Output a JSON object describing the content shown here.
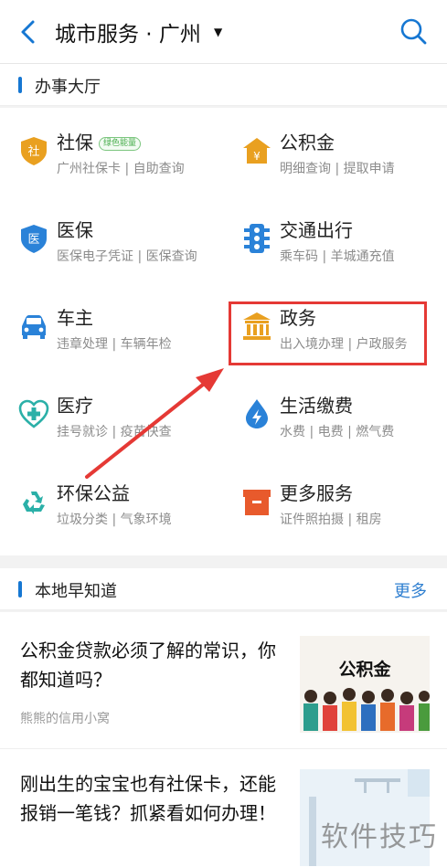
{
  "header": {
    "title": "城市服务 · 广州",
    "caret": "▼"
  },
  "hall": {
    "title": "办事大厅",
    "services": [
      {
        "name": "社保",
        "badge": "绿色能量",
        "sub": "广州社保卡 | 自助查询",
        "icon": "social-security-icon",
        "color": "#e9a020"
      },
      {
        "name": "公积金",
        "sub": "明细查询 | 提取申请",
        "icon": "housing-fund-icon",
        "color": "#e9a020"
      },
      {
        "name": "医保",
        "sub": "医保电子凭证 | 医保查询",
        "icon": "medical-insurance-icon",
        "color": "#2a82d8"
      },
      {
        "name": "交通出行",
        "sub": "乘车码 | 羊城通充值",
        "icon": "traffic-light-icon",
        "color": "#2a82d8"
      },
      {
        "name": "车主",
        "sub": "违章处理 | 车辆年检",
        "icon": "car-icon",
        "color": "#2a82d8"
      },
      {
        "name": "政务",
        "sub": "出入境办理 | 户政服务",
        "icon": "government-building-icon",
        "color": "#e9a020"
      },
      {
        "name": "医疗",
        "sub": "挂号就诊 | 疫苗快查",
        "icon": "medical-cross-icon",
        "color": "#2bb0a8"
      },
      {
        "name": "生活缴费",
        "sub": "水费 | 电费 | 燃气费",
        "icon": "utility-bolt-icon",
        "color": "#2a82d8"
      },
      {
        "name": "环保公益",
        "sub": "垃圾分类 | 气象环境",
        "icon": "recycle-icon",
        "color": "#2bb0a8"
      },
      {
        "name": "更多服务",
        "sub": "证件照拍摄 | 租房",
        "icon": "more-services-box-icon",
        "color": "#e85a2c"
      }
    ]
  },
  "local": {
    "title": "本地早知道",
    "more": "更多",
    "articles": [
      {
        "title": "公积金贷款必须了解的常识，你都知道吗？",
        "source": "熊熊的信用小窝",
        "thumb_caption": "公积金"
      },
      {
        "title": "刚出生的宝宝也有社保卡，还能报销一笔钱？抓紧看如何办理！",
        "source": ""
      }
    ]
  },
  "watermark": "软件技巧",
  "colors": {
    "accent_blue": "#1677d2",
    "annotation_red": "#e53935"
  }
}
